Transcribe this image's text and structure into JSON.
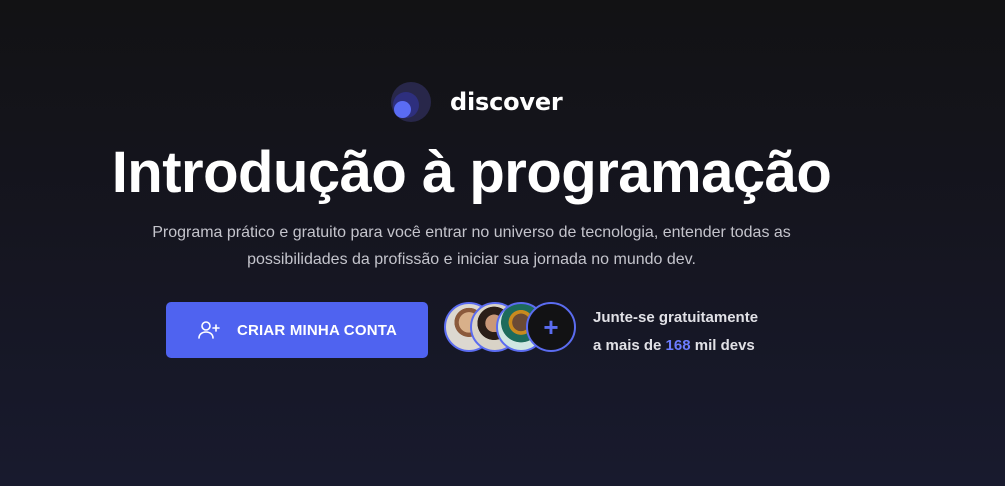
{
  "brand": {
    "name": "discover"
  },
  "hero": {
    "title": "Introdução à programação",
    "subtitle": "Programa prático e gratuito para você entrar no universo de tecnologia, entender todas as possibilidades da profissão e iniciar sua jornada no mundo dev."
  },
  "cta": {
    "label": "CRIAR MINHA CONTA",
    "icon": "user-plus-icon"
  },
  "community": {
    "more_symbol": "+",
    "line1": "Junte-se gratuitamente",
    "line2_prefix": "a mais de ",
    "count": "168",
    "line2_suffix": " mil devs"
  },
  "colors": {
    "accent": "#4f63f0",
    "highlight": "#6b7cff",
    "background": "#121214"
  }
}
